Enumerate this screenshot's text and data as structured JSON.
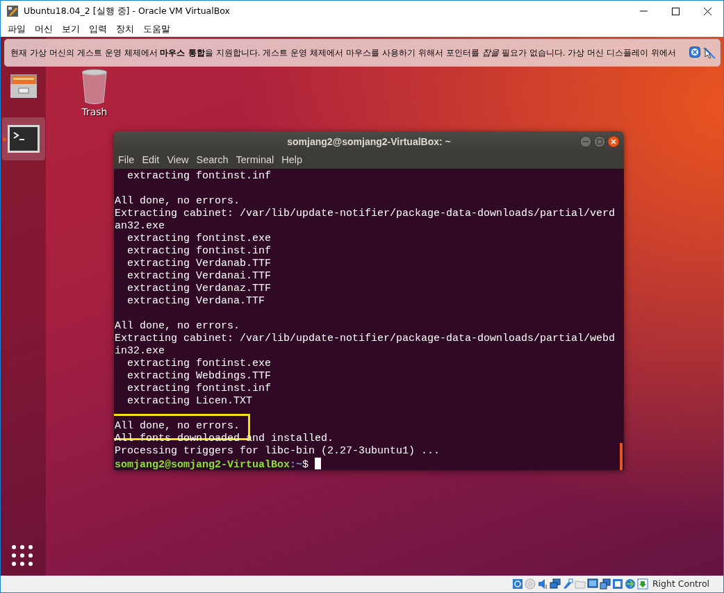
{
  "window": {
    "title": "Ubuntu18.04_2 [실행 중] - Oracle VM VirtualBox"
  },
  "menu": [
    "파일",
    "머신",
    "보기",
    "입력",
    "장치",
    "도움말"
  ],
  "notification": {
    "text": "현재 가상 머신의 게스트 운영 체제에서 **마우스 통합**을 지원합니다. 게스트 운영 체제에서 마우스를 사용하기 위해서 포인터를 *잡을* 필요가 없습니다. 가상 머신 디스플레이 위에서"
  },
  "dock": {
    "items": [
      {
        "kind": "files",
        "running": false
      },
      {
        "kind": "terminal",
        "running": true
      }
    ]
  },
  "desktop": {
    "icons": [
      {
        "kind": "trash",
        "label": "Trash"
      }
    ]
  },
  "terminal": {
    "title": "somjang2@somjang2-VirtualBox: ~",
    "menu": [
      "File",
      "Edit",
      "View",
      "Search",
      "Terminal",
      "Help"
    ],
    "lines": [
      {
        "kind": "output",
        "text": "  extracting fontinst.inf",
        "highlighted": false
      },
      {
        "kind": "blank"
      },
      {
        "kind": "output",
        "text": "All done, no errors.",
        "highlighted": false
      },
      {
        "kind": "output",
        "text": "Extracting cabinet: /var/lib/update-notifier/package-data-downloads/partial/verd",
        "highlighted": false
      },
      {
        "kind": "output",
        "text": "an32.exe",
        "highlighted": false
      },
      {
        "kind": "output",
        "text": "  extracting fontinst.exe",
        "highlighted": false
      },
      {
        "kind": "output",
        "text": "  extracting fontinst.inf",
        "highlighted": false
      },
      {
        "kind": "output",
        "text": "  extracting Verdanab.TTF",
        "highlighted": false
      },
      {
        "kind": "output",
        "text": "  extracting Verdanai.TTF",
        "highlighted": false
      },
      {
        "kind": "output",
        "text": "  extracting Verdanaz.TTF",
        "highlighted": false
      },
      {
        "kind": "output",
        "text": "  extracting Verdana.TTF",
        "highlighted": false
      },
      {
        "kind": "blank"
      },
      {
        "kind": "output",
        "text": "All done, no errors.",
        "highlighted": false
      },
      {
        "kind": "output",
        "text": "Extracting cabinet: /var/lib/update-notifier/package-data-downloads/partial/webd",
        "highlighted": false
      },
      {
        "kind": "output",
        "text": "in32.exe",
        "highlighted": false
      },
      {
        "kind": "output",
        "text": "  extracting fontinst.exe",
        "highlighted": false
      },
      {
        "kind": "output",
        "text": "  extracting Webdings.TTF",
        "highlighted": false
      },
      {
        "kind": "output",
        "text": "  extracting fontinst.inf",
        "highlighted": false
      },
      {
        "kind": "output",
        "text": "  extracting Licen.TXT",
        "highlighted": false
      },
      {
        "kind": "blank"
      },
      {
        "kind": "output",
        "text": "All done, no errors.",
        "highlighted": true
      },
      {
        "kind": "output",
        "text": "All fonts downloaded and installed.",
        "highlighted": false
      },
      {
        "kind": "output",
        "text": "Processing triggers for libc-bin (2.27-3ubuntu1) ...",
        "highlighted": false
      },
      {
        "kind": "prompt",
        "user": "somjang2@somjang2-VirtualBox",
        "path": ":~",
        "symbol": "$"
      }
    ]
  },
  "status_bar": {
    "host_key": "Right Control"
  }
}
